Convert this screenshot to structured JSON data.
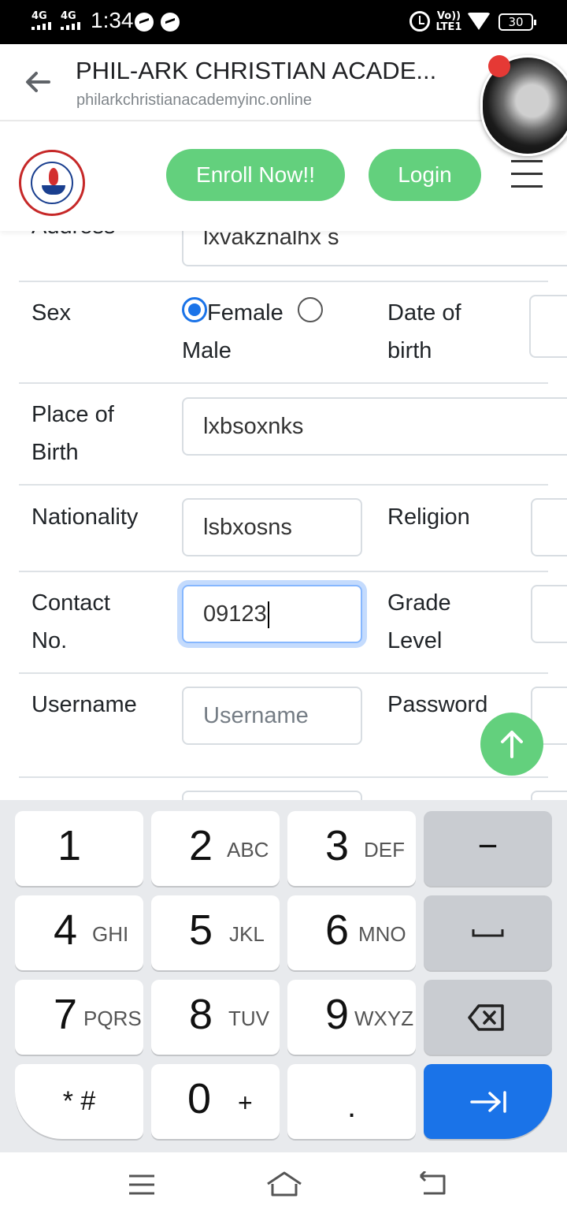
{
  "status_bar": {
    "network_1": "4G",
    "network_2": "4G",
    "time": "1:34",
    "volte": "Vo)) LTE1",
    "battery": "30"
  },
  "browser": {
    "title": "PHIL-ARK CHRISTIAN ACADE...",
    "url": "philarkchristianacademyinc.online"
  },
  "navbar": {
    "enroll_label": "Enroll Now!!",
    "login_label": "Login"
  },
  "form": {
    "address_label": "Address",
    "address_value": "lxvakznalhx s",
    "sex_label": "Sex",
    "sex_options": [
      "Female",
      "Male"
    ],
    "sex_selected": "Female",
    "dob_label_1": "Date of",
    "dob_label_2": "birth",
    "pob_label_1": "Place of",
    "pob_label_2": "Birth",
    "pob_value": "lxbsoxnks",
    "nationality_label": "Nationality",
    "nationality_value": "lsbxosns",
    "religion_label": "Religion",
    "contact_label_1": "Contact",
    "contact_label_2": "No.",
    "contact_value": "09123",
    "grade_label_1": "Grade",
    "grade_label_2": "Level",
    "username_label": "Username",
    "username_placeholder": "Username",
    "password_label": "Password"
  },
  "keyboard": {
    "rows": [
      [
        {
          "digit": "1",
          "letters": ""
        },
        {
          "digit": "2",
          "letters": "ABC"
        },
        {
          "digit": "3",
          "letters": "DEF"
        },
        {
          "symbol": "−"
        }
      ],
      [
        {
          "digit": "4",
          "letters": "GHI"
        },
        {
          "digit": "5",
          "letters": "JKL"
        },
        {
          "digit": "6",
          "letters": "MNO"
        },
        {
          "symbol": "␣"
        }
      ],
      [
        {
          "digit": "7",
          "letters": "PQRS"
        },
        {
          "digit": "8",
          "letters": "TUV"
        },
        {
          "digit": "9",
          "letters": "WXYZ"
        },
        {
          "symbol": "backspace"
        }
      ],
      [
        {
          "symbol": "* #"
        },
        {
          "digit": "0",
          "letters": "+"
        },
        {
          "symbol": "."
        },
        {
          "symbol": "next"
        }
      ]
    ]
  },
  "icons": {
    "back": "arrow-left-icon",
    "menu": "hamburger-icon",
    "scroll_top": "arrow-up-icon",
    "backspace": "backspace-icon",
    "next": "tab-next-icon"
  },
  "colors": {
    "accent_green": "#63d07d",
    "keyboard_blue": "#1a73e8",
    "focus_ring": "#c4dbfd"
  }
}
